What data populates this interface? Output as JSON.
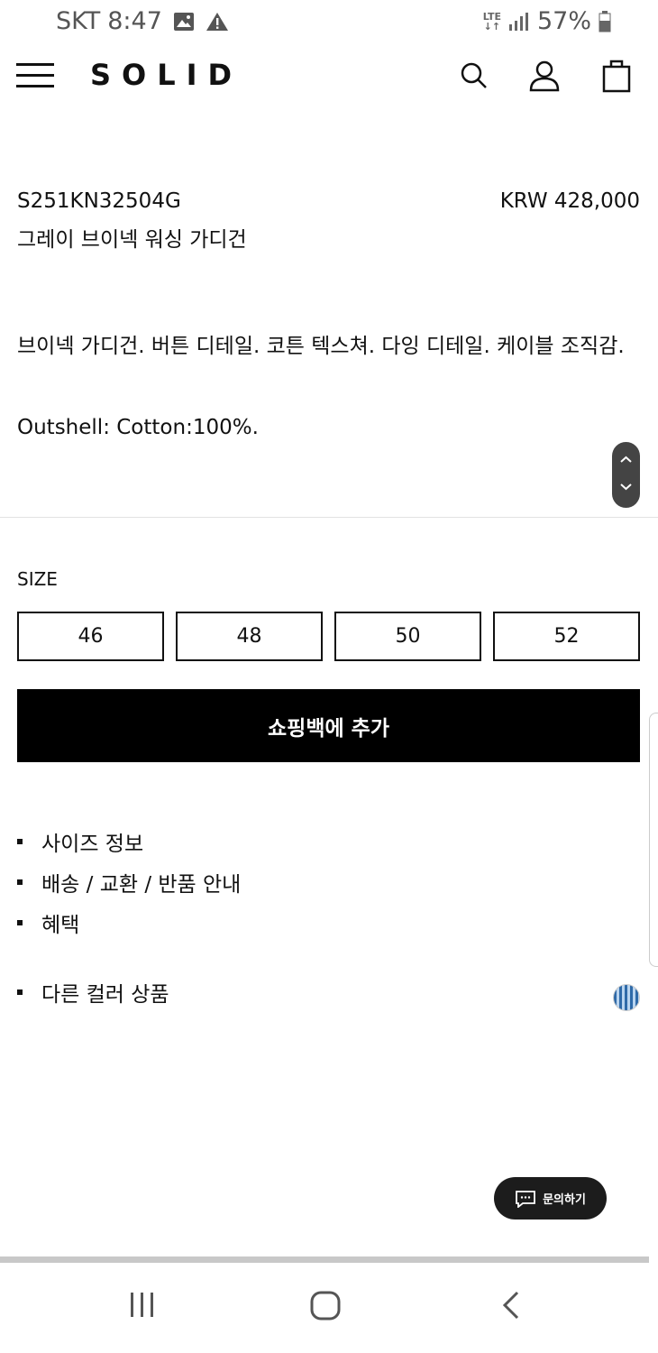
{
  "status_bar": {
    "carrier": "SKT",
    "time": "8:47",
    "network_top": "LTE",
    "network_bottom": "↓↑",
    "battery": "57%"
  },
  "header": {
    "logo": "SOLID"
  },
  "product": {
    "code": "S251KN32504G",
    "price": "KRW 428,000",
    "name": "그레이 브이넥 워싱 가디건",
    "description": "브이넥 가디건. 버튼 디테일. 코튼 텍스쳐. 다잉 디테일. 케이블 조직감.",
    "material": "Outshell: Cotton:100%."
  },
  "size": {
    "label": "SIZE",
    "options": [
      "46",
      "48",
      "50",
      "52"
    ]
  },
  "add_to_bag_label": "쇼핑백에 추가",
  "info_links": [
    "사이즈 정보",
    "배송 / 교환 / 반품 안내",
    "혜택"
  ],
  "other_colors_label": "다른 컬러 상품",
  "chat_label": "문의하기",
  "icons": {
    "menu": "hamburger-icon",
    "search": "search-icon",
    "account": "user-icon",
    "bag": "shopping-bag-icon",
    "chat": "chat-icon"
  },
  "colors": {
    "primary": "#000000",
    "button_text": "#ffffff",
    "chat_bg": "#1c1c1c"
  }
}
